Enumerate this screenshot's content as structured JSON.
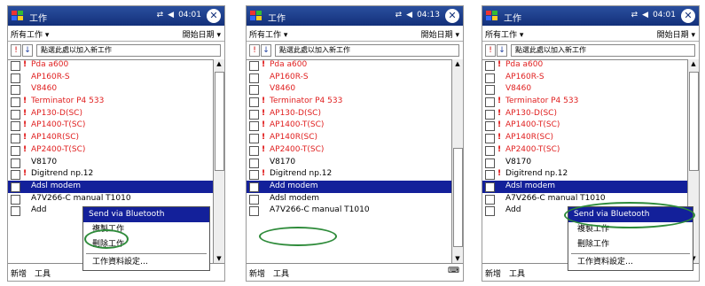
{
  "screens": [
    {
      "title": "工作",
      "time": "04:01",
      "filter": "所有工作",
      "sort": "開始日期",
      "entry": "點選此處以加入新工作",
      "items": [
        {
          "t": "Pda a600",
          "red": true,
          "ex": true
        },
        {
          "t": "AP160R-S",
          "red": true,
          "ex": false
        },
        {
          "t": "V8460",
          "red": true,
          "ex": false
        },
        {
          "t": "Terminator P4 533",
          "red": true,
          "ex": true
        },
        {
          "t": "AP130-D(SC)",
          "red": true,
          "ex": true
        },
        {
          "t": "AP1400-T(SC)",
          "red": true,
          "ex": true
        },
        {
          "t": "AP140R(SC)",
          "red": true,
          "ex": true
        },
        {
          "t": "AP2400-T(SC)",
          "red": true,
          "ex": true
        },
        {
          "t": "V8170",
          "red": false,
          "ex": false
        },
        {
          "t": "Digitrend np.12",
          "red": false,
          "ex": true
        },
        {
          "t": "Adsl modem",
          "red": false,
          "ex": false,
          "sel": true
        },
        {
          "t": "A7V266-C manual T1010",
          "red": false,
          "ex": false
        },
        {
          "t": "Add",
          "red": false,
          "ex": false
        }
      ],
      "menu": [
        "新增",
        "工具"
      ],
      "popup": {
        "head": "Send via Bluetooth",
        "items": [
          "複製工作",
          "刪除工作",
          "工作資料設定…"
        ]
      }
    },
    {
      "title": "工作",
      "time": "04:13",
      "filter": "所有工作",
      "sort": "開始日期",
      "entry": "點選此處以加入新工作",
      "items": [
        {
          "t": "Pda a600",
          "red": true,
          "ex": true
        },
        {
          "t": "AP160R-S",
          "red": true,
          "ex": false
        },
        {
          "t": "V8460",
          "red": true,
          "ex": false
        },
        {
          "t": "Terminator P4 533",
          "red": true,
          "ex": true
        },
        {
          "t": "AP130-D(SC)",
          "red": true,
          "ex": true
        },
        {
          "t": "AP1400-T(SC)",
          "red": true,
          "ex": true
        },
        {
          "t": "AP140R(SC)",
          "red": true,
          "ex": true
        },
        {
          "t": "AP2400-T(SC)",
          "red": true,
          "ex": true
        },
        {
          "t": "V8170",
          "red": false,
          "ex": false
        },
        {
          "t": "Digitrend np.12",
          "red": false,
          "ex": true
        },
        {
          "t": "Add modem",
          "red": false,
          "ex": false,
          "sel": true
        },
        {
          "t": "Adsl modem",
          "red": false,
          "ex": false
        },
        {
          "t": "A7V266-C manual T1010",
          "red": false,
          "ex": false
        }
      ],
      "menu": [
        "新增",
        "工具"
      ]
    },
    {
      "title": "工作",
      "time": "04:01",
      "filter": "所有工作",
      "sort": "開始日期",
      "entry": "點選此處以加入新工作",
      "items": [
        {
          "t": "Pda a600",
          "red": true,
          "ex": true
        },
        {
          "t": "AP160R-S",
          "red": true,
          "ex": false
        },
        {
          "t": "V8460",
          "red": true,
          "ex": false
        },
        {
          "t": "Terminator P4 533",
          "red": true,
          "ex": true
        },
        {
          "t": "AP130-D(SC)",
          "red": true,
          "ex": true
        },
        {
          "t": "AP1400-T(SC)",
          "red": true,
          "ex": true
        },
        {
          "t": "AP140R(SC)",
          "red": true,
          "ex": true
        },
        {
          "t": "AP2400-T(SC)",
          "red": true,
          "ex": true
        },
        {
          "t": "V8170",
          "red": false,
          "ex": false
        },
        {
          "t": "Digitrend np.12",
          "red": false,
          "ex": true
        },
        {
          "t": "Adsl modem",
          "red": false,
          "ex": false,
          "sel": true
        },
        {
          "t": "A7V266-C manual T1010",
          "red": false,
          "ex": false
        },
        {
          "t": "Add",
          "red": false,
          "ex": false
        }
      ],
      "menu": [
        "新增",
        "工具"
      ],
      "popup": {
        "head": "Send via Bluetooth",
        "items": [
          "複製工作",
          "刪除工作",
          "工作資料設定…"
        ]
      }
    }
  ]
}
